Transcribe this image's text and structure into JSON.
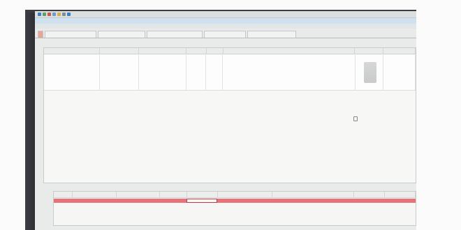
{
  "toolbar": {
    "icons": [
      "back-icon",
      "forward-icon",
      "save-icon",
      "refresh-icon",
      "print-icon",
      "help-icon",
      "home-icon"
    ],
    "colors": [
      "#3b7fc4",
      "#5fa05c",
      "#c75c4c",
      "#6a9bd1",
      "#d8b04b",
      "#7a8d99",
      "#3b7fc4"
    ]
  },
  "breadcrumb": "",
  "breadcrumb2": "",
  "tabs": [
    ""
  ],
  "panel": {
    "label": "",
    "columns": [
      "",
      "",
      "",
      "",
      "",
      "",
      "",
      ""
    ],
    "row": {
      "c1": "",
      "c2": "",
      "c3": "",
      "c4": "",
      "c5": "",
      "notes": [
        "",
        "",
        "",
        ""
      ]
    }
  },
  "bottom": {
    "label": "",
    "columns": [
      "",
      "",
      "",
      "",
      "",
      "",
      "",
      "",
      ""
    ],
    "row": [
      "",
      "",
      "",
      "",
      "",
      "",
      "",
      "",
      ""
    ]
  },
  "footer": {
    "checkbox_label": "",
    "left_text": "",
    "buttons": [
      "",
      "",
      ""
    ]
  },
  "accent": {
    "active_tab": "#e8a593",
    "selected_row": "#e8727a",
    "breadcrumb_bg": "#cfe0ef"
  }
}
